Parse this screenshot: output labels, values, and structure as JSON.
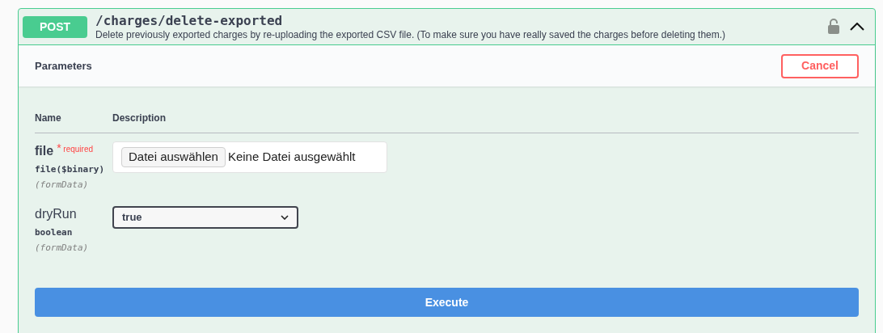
{
  "operation": {
    "method": "POST",
    "path": "/charges/delete-exported",
    "description": "Delete previously exported charges by re-uploading the exported CSV file. (To make sure you have really saved the charges before deleting them.)",
    "locked": false,
    "expanded": true
  },
  "parameters_bar": {
    "title": "Parameters",
    "cancel": "Cancel"
  },
  "table": {
    "columns": [
      "Name",
      "Description"
    ],
    "rows": [
      {
        "name": "file",
        "required": true,
        "required_mark": "*",
        "required_label": "required",
        "type": "file($binary)",
        "location": "(formData)",
        "kind": "file",
        "button": "Datei auswählen",
        "value": "Keine Datei ausgewählt"
      },
      {
        "name": "dryRun",
        "required": false,
        "type": "boolean",
        "location": "(formData)",
        "kind": "select",
        "value": "true"
      }
    ]
  },
  "execute": "Execute"
}
